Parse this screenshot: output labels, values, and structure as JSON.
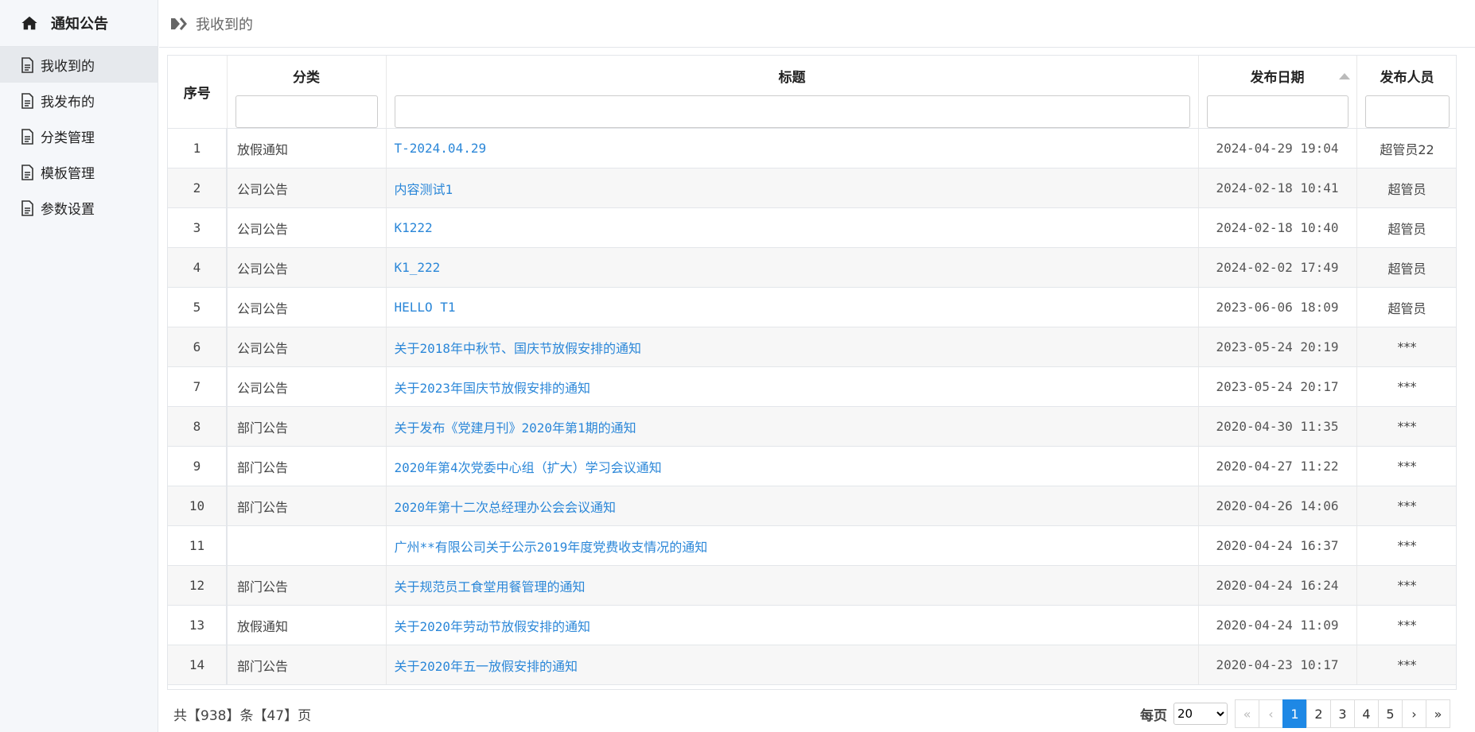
{
  "sidebar": {
    "title": "通知公告",
    "items": [
      {
        "label": "我收到的",
        "active": true
      },
      {
        "label": "我发布的",
        "active": false
      },
      {
        "label": "分类管理",
        "active": false
      },
      {
        "label": "模板管理",
        "active": false
      },
      {
        "label": "参数设置",
        "active": false
      }
    ]
  },
  "breadcrumb": "我收到的",
  "table": {
    "columns": {
      "no": "序号",
      "category": "分类",
      "title": "标题",
      "date": "发布日期",
      "publisher": "发布人员"
    },
    "rows": [
      {
        "no": "1",
        "category": "放假通知",
        "title": "T-2024.04.29",
        "date": "2024-04-29 19:04",
        "publisher": "超管员22"
      },
      {
        "no": "2",
        "category": "公司公告",
        "title": "内容测试1",
        "date": "2024-02-18 10:41",
        "publisher": "超管员"
      },
      {
        "no": "3",
        "category": "公司公告",
        "title": "K1222",
        "date": "2024-02-18 10:40",
        "publisher": "超管员"
      },
      {
        "no": "4",
        "category": "公司公告",
        "title": "K1_222",
        "date": "2024-02-02 17:49",
        "publisher": "超管员"
      },
      {
        "no": "5",
        "category": "公司公告",
        "title": "HELLO T1",
        "date": "2023-06-06 18:09",
        "publisher": "超管员"
      },
      {
        "no": "6",
        "category": "公司公告",
        "title": "关于2018年中秋节、国庆节放假安排的通知",
        "date": "2023-05-24 20:19",
        "publisher": "***"
      },
      {
        "no": "7",
        "category": "公司公告",
        "title": "关于2023年国庆节放假安排的通知",
        "date": "2023-05-24 20:17",
        "publisher": "***"
      },
      {
        "no": "8",
        "category": "部门公告",
        "title": "关于发布《党建月刊》2020年第1期的通知",
        "date": "2020-04-30 11:35",
        "publisher": "***"
      },
      {
        "no": "9",
        "category": "部门公告",
        "title": "2020年第4次党委中心组（扩大）学习会议通知",
        "date": "2020-04-27 11:22",
        "publisher": "***"
      },
      {
        "no": "10",
        "category": "部门公告",
        "title": "2020年第十二次总经理办公会会议通知",
        "date": "2020-04-26 14:06",
        "publisher": "***"
      },
      {
        "no": "11",
        "category": "",
        "title": "广州**有限公司关于公示2019年度党费收支情况的通知",
        "date": "2020-04-24 16:37",
        "publisher": "***"
      },
      {
        "no": "12",
        "category": "部门公告",
        "title": "关于规范员工食堂用餐管理的通知",
        "date": "2020-04-24 16:24",
        "publisher": "***"
      },
      {
        "no": "13",
        "category": "放假通知",
        "title": "关于2020年劳动节放假安排的通知",
        "date": "2020-04-24 11:09",
        "publisher": "***"
      },
      {
        "no": "14",
        "category": "部门公告",
        "title": "关于2020年五一放假安排的通知",
        "date": "2020-04-23 10:17",
        "publisher": "***"
      }
    ]
  },
  "pagination": {
    "summary": "共【938】条【47】页",
    "per_page_label": "每页",
    "per_page_value": "20",
    "first": "«",
    "prev": "‹",
    "pages": [
      "1",
      "2",
      "3",
      "4",
      "5"
    ],
    "current": "1",
    "next": "›",
    "last": "»"
  },
  "colors": {
    "link": "#2b87d8",
    "active_page": "#1e88e5"
  }
}
